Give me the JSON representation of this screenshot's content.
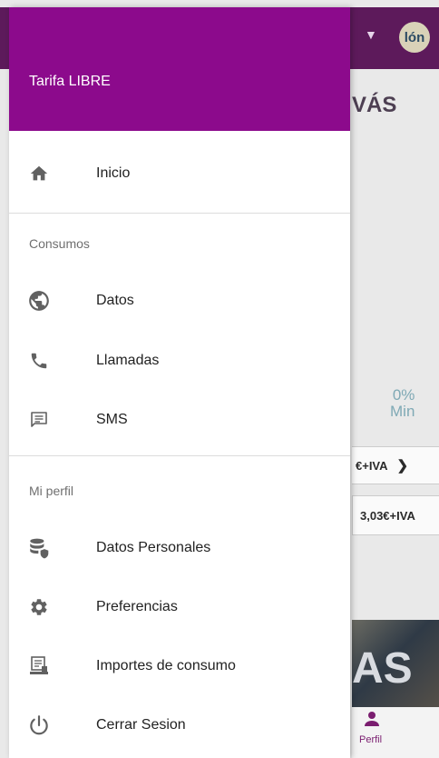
{
  "background_app": {
    "section_title": "VÁS",
    "usage_percent": "0%",
    "usage_unit": "Min",
    "price_box_1": "€+IVA",
    "price_box_2": "3,03€+IVA",
    "photo_text": "AS",
    "logo_text": "lón",
    "bottom_nav_profile_label": "Perfil"
  },
  "drawer": {
    "plan_name": "Tarifa LIBRE",
    "home": {
      "label": "Inicio",
      "icon": "home-icon"
    },
    "sections": {
      "consumos": "Consumos",
      "mi_perfil": "Mi perfil"
    },
    "consumos_items": [
      {
        "label": "Datos",
        "icon": "globe-icon"
      },
      {
        "label": "Llamadas",
        "icon": "phone-icon"
      },
      {
        "label": "SMS",
        "icon": "message-icon"
      }
    ],
    "perfil_items": [
      {
        "label": "Datos Personales",
        "icon": "database-shield-icon"
      },
      {
        "label": "Preferencias",
        "icon": "gear-icon"
      },
      {
        "label": "Importes de consumo",
        "icon": "billing-computer-icon"
      },
      {
        "label": "Cerrar Sesion",
        "icon": "power-icon"
      }
    ]
  },
  "colors": {
    "drawer_header": "#8c0a8c",
    "app_topbar": "#5d1a5b",
    "icon_gray": "#616161",
    "section_text": "#6f6f6f"
  }
}
